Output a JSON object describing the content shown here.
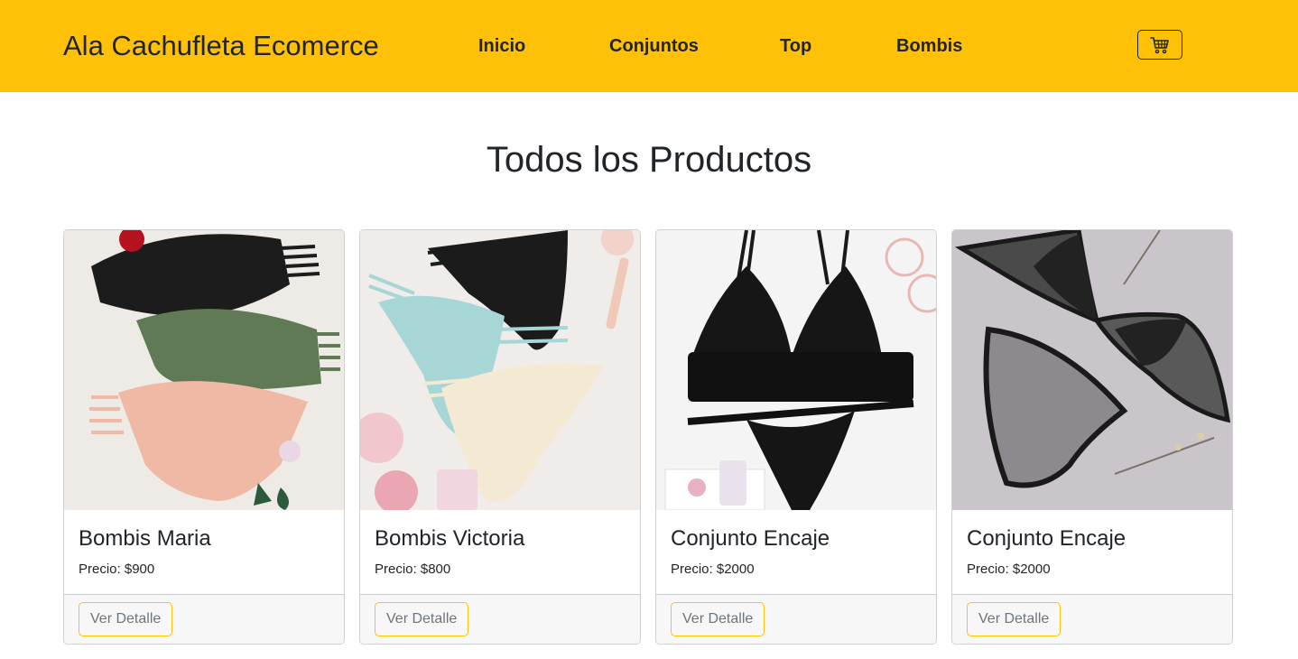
{
  "navbar": {
    "brand": "Ala Cachufleta Ecomerce",
    "links": [
      {
        "label": "Inicio"
      },
      {
        "label": "Conjuntos"
      },
      {
        "label": "Top"
      },
      {
        "label": "Bombis"
      }
    ],
    "cart_icon": "shopping-cart-icon",
    "background_color": "#ffc107"
  },
  "main": {
    "title": "Todos los Productos",
    "products": [
      {
        "name": "Bombis Maria",
        "price": "Precio: $900",
        "button_label": "Ver Detalle",
        "image": "product-photo-panties-set"
      },
      {
        "name": "Bombis Victoria",
        "price": "Precio: $800",
        "button_label": "Ver Detalle",
        "image": "product-photo-strappy-thongs"
      },
      {
        "name": "Conjunto Encaje",
        "price": "Precio: $2000",
        "button_label": "Ver Detalle",
        "image": "product-photo-black-lace-set"
      },
      {
        "name": "Conjunto Encaje",
        "price": "Precio: $2000",
        "button_label": "Ver Detalle",
        "image": "product-photo-grey-lace-set"
      }
    ]
  },
  "colors": {
    "accent": "#ffc107",
    "text": "#212529",
    "muted": "#6c757d",
    "card_footer": "#f7f7f7"
  }
}
